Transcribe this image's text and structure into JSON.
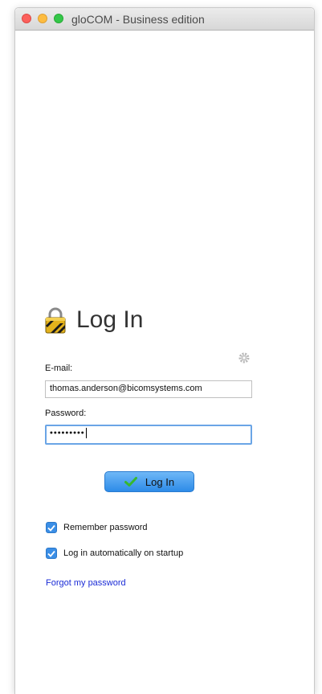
{
  "window": {
    "title": "gloCOM - Business edition"
  },
  "login": {
    "title": "Log In",
    "email_label": "E-mail:",
    "email_value": "thomas.anderson@bicomsystems.com",
    "password_label": "Password:",
    "password_value": "•••••••••",
    "login_button": "Log In",
    "remember_password": "Remember password",
    "remember_password_checked": true,
    "auto_login": "Log in automatically on startup",
    "auto_login_checked": true,
    "forgot_password": "Forgot my password"
  },
  "colors": {
    "accent": "#3a8ee6",
    "link": "#1a2bd6"
  },
  "icons": {
    "lock": "lock-icon",
    "gear": "gear-icon",
    "check": "check-icon"
  }
}
